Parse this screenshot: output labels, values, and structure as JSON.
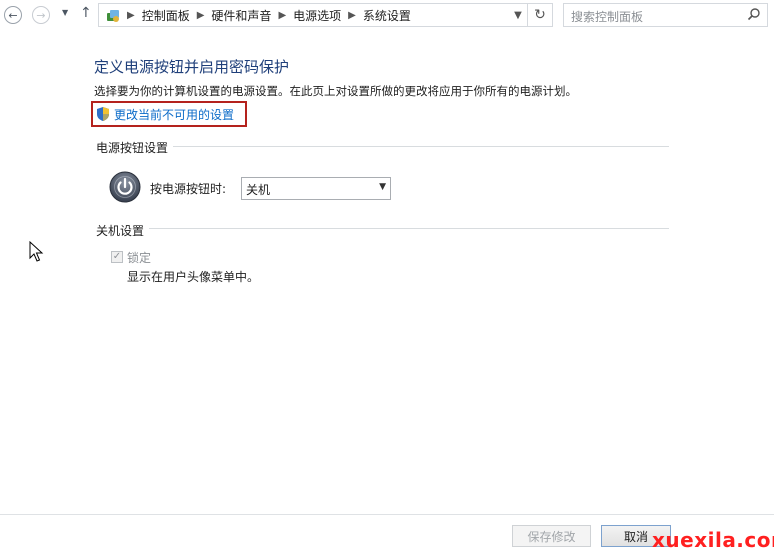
{
  "address_bar": {
    "breadcrumbs": [
      "控制面板",
      "硬件和声音",
      "电源选项",
      "系统设置"
    ]
  },
  "search": {
    "placeholder": "搜索控制面板"
  },
  "page": {
    "title": "定义电源按钮并启用密码保护",
    "description": "选择要为你的计算机设置的电源设置。在此页上对设置所做的更改将应用于你所有的电源计划。",
    "change_link": "更改当前不可用的设置"
  },
  "power_button_section": {
    "heading": "电源按钮设置",
    "label": "按电源按钮时:",
    "selected_value": "关机"
  },
  "shutdown_section": {
    "heading": "关机设置",
    "lock": {
      "label": "锁定",
      "checked": true,
      "enabled": false
    },
    "lock_description": "显示在用户头像菜单中。"
  },
  "footer": {
    "save_label": "保存修改",
    "cancel_label": "取消"
  },
  "watermark": "xuexila.com",
  "colors": {
    "title": "#1f3f7a",
    "link": "#0b6bc8",
    "highlight_border": "#b4221d",
    "watermark": "#ff2020"
  }
}
